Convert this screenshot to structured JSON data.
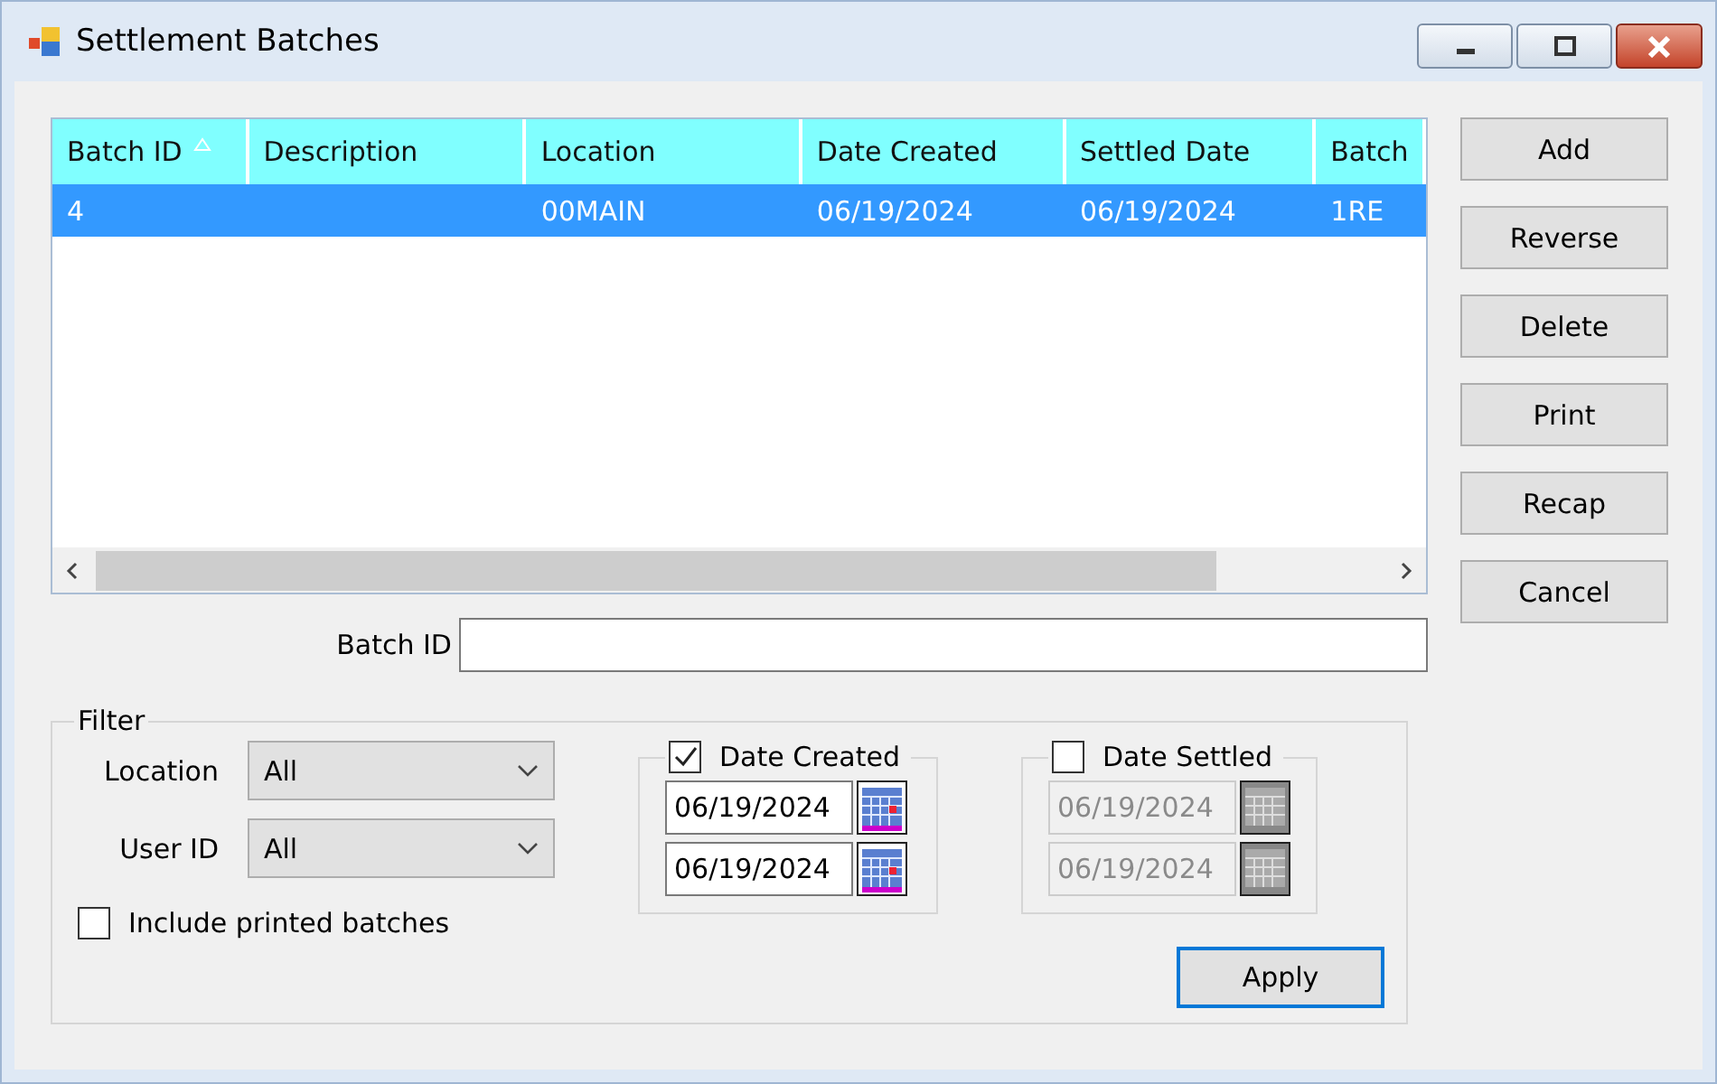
{
  "window": {
    "title": "Settlement Batches"
  },
  "table": {
    "columns": [
      {
        "label": "Batch ID",
        "sorted": true
      },
      {
        "label": "Description",
        "sorted": false
      },
      {
        "label": "Location",
        "sorted": false
      },
      {
        "label": "Date Created",
        "sorted": false
      },
      {
        "label": "Settled Date",
        "sorted": false
      },
      {
        "label": "Batch",
        "sorted": false
      }
    ],
    "rows": [
      {
        "selected": true,
        "cells": [
          "4",
          null,
          "00MAIN",
          "06/19/2024",
          "06/19/2024",
          "1RE"
        ]
      }
    ]
  },
  "actions": [
    "Add",
    "Reverse",
    "Delete",
    "Print",
    "Recap",
    "Cancel"
  ],
  "batch_id": {
    "label": "Batch ID"
  },
  "filter": {
    "title": "Filter",
    "location": {
      "label": "Location",
      "value": "All"
    },
    "user_id": {
      "label": "User ID",
      "value": "All"
    },
    "include_printed": {
      "label": "Include printed batches",
      "checked": false
    },
    "date_created": {
      "label": "Date Created",
      "checked": true,
      "from": "06/19/2024",
      "to": "06/19/2024"
    },
    "date_settled": {
      "label": "Date Settled",
      "checked": false,
      "from": "06/19/2024",
      "to": "06/19/2024"
    },
    "apply": "Apply"
  }
}
